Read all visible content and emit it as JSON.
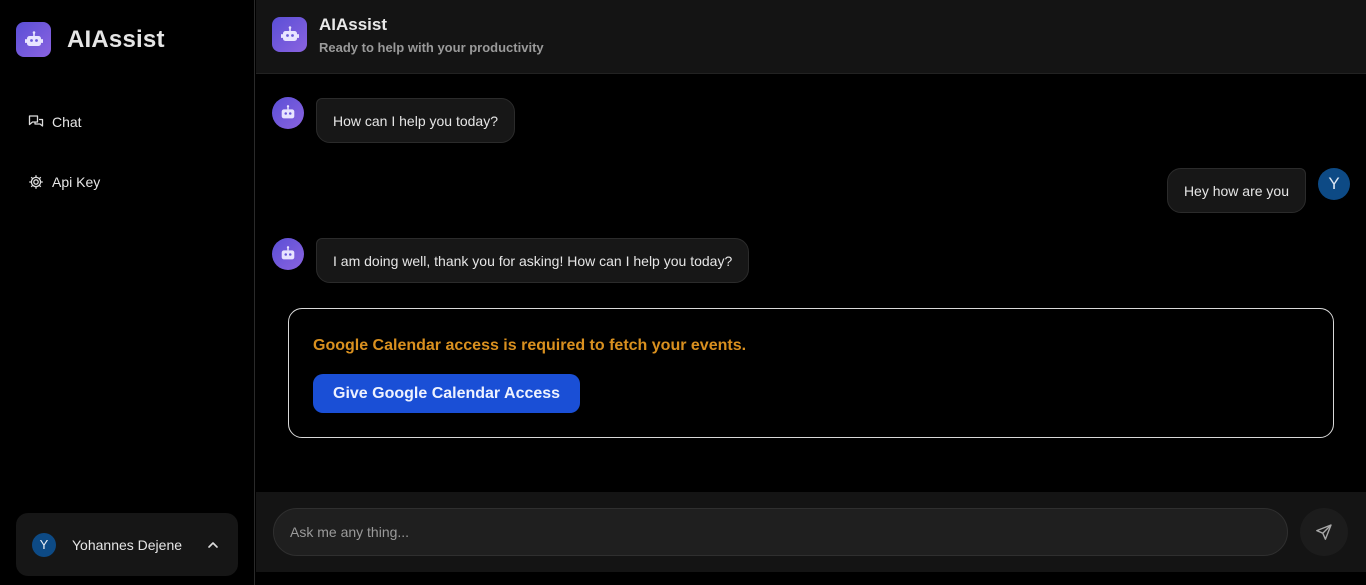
{
  "app": {
    "brand_name": "AIAssist",
    "accent": "#6a59dc"
  },
  "sidebar": {
    "items": [
      {
        "label": "Chat",
        "icon": "chat-bubbles-icon"
      },
      {
        "label": "Api Key",
        "icon": "gear-icon"
      }
    ],
    "user": {
      "initial": "Y",
      "name": "Yohannes Dejene"
    }
  },
  "header": {
    "title": "AIAssist",
    "subtitle": "Ready to help with your productivity"
  },
  "messages": [
    {
      "role": "bot",
      "text": "How can I help you today?"
    },
    {
      "role": "user",
      "initial": "Y",
      "text": "Hey how are you"
    },
    {
      "role": "bot",
      "text": "I am doing well, thank you for asking! How can I help you today?"
    }
  ],
  "access_card": {
    "message": "Google Calendar access is required to fetch your events.",
    "button_label": "Give Google Calendar Access",
    "message_color": "#d9901f",
    "button_color": "#1a4fd6"
  },
  "composer": {
    "placeholder": "Ask me any thing...",
    "value": ""
  }
}
